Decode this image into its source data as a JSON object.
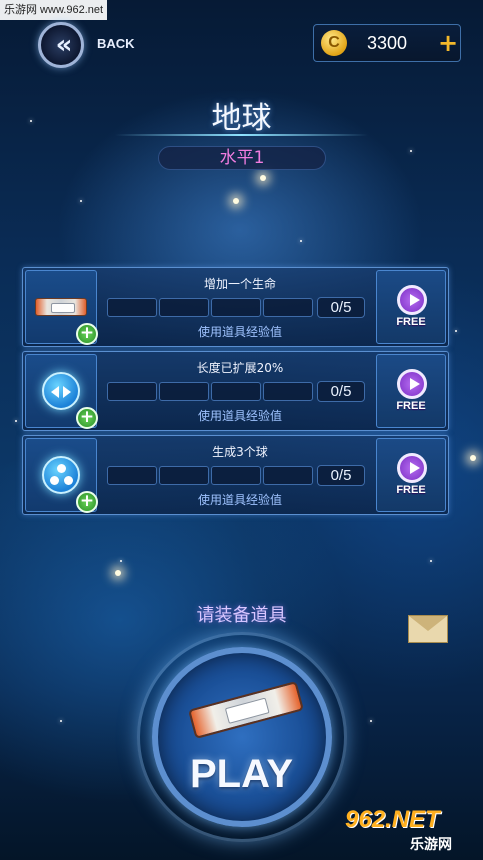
{
  "watermark_top": "乐游网 www.962.net",
  "header": {
    "back_label": "BACK",
    "coins": "3300",
    "coin_symbol": "C",
    "add_symbol": "+"
  },
  "title": "地球",
  "level": "水平1",
  "powerups": [
    {
      "name": "增加一个生命",
      "progress": "0/5",
      "subtitle": "使用道具经验值",
      "icon": "paddle-icon",
      "free_label": "FREE"
    },
    {
      "name": "长度已扩展20%",
      "progress": "0/5",
      "subtitle": "使用道具经验值",
      "icon": "expand-icon",
      "free_label": "FREE"
    },
    {
      "name": "生成3个球",
      "progress": "0/5",
      "subtitle": "使用道具经验值",
      "icon": "multiball-icon",
      "free_label": "FREE"
    }
  ],
  "equip_prompt": "请装备道具",
  "play_label": "PLAY",
  "watermark_logo": "962.NET",
  "watermark_logo_sub": "乐游网",
  "colors": {
    "level_text": "#f27de0",
    "coin": "#e2a416",
    "accent": "#5a8fd0"
  }
}
